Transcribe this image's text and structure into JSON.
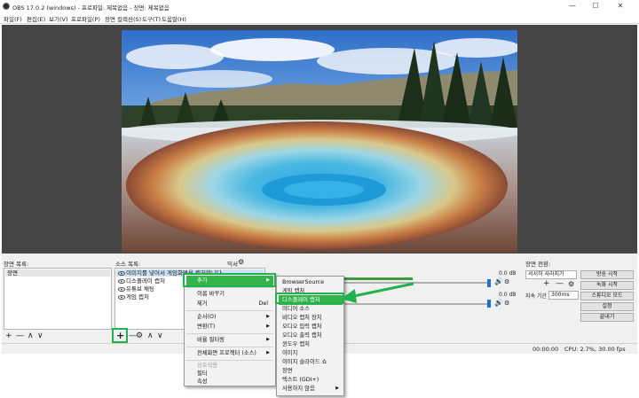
{
  "window": {
    "title": "OBS 17.0.2 (windows) - 프로파일: 제목없음 - 장면: 제목없음",
    "minimize": "—",
    "maximize": "☐",
    "close": "✕"
  },
  "menubar": [
    "파일(F)",
    "편집(E)",
    "보기(V)",
    "프로파일(P)",
    "장면 컬렉션(S)",
    "도구(T)",
    "도움말(H)"
  ],
  "panels": {
    "scenes_label": "장면 목록:",
    "scenes": [
      "장면"
    ],
    "sources_label": "소스 목록:",
    "sources": [
      "이미지를 넣어서 게임화면을 캡처합니다",
      "디스플레이 캡처",
      "유튜브 채팅",
      "게임 캡처"
    ],
    "mixer_label": "믹서",
    "transition_label": "장면 전환:",
    "transition_value": "서서히 사라지기",
    "duration_label": "지속 기간",
    "duration_value": "300ms"
  },
  "toolbar_glyphs": {
    "plus": "+",
    "minus": "—",
    "up": "∧",
    "down": "∨",
    "gear": "⚙"
  },
  "mixer": [
    {
      "level": "0.0 dB",
      "fill": 0.68
    },
    {
      "level": "0.0 dB",
      "fill": 0.08
    }
  ],
  "buttons": [
    "방송 시작",
    "녹화 시작",
    "스튜디오 모드",
    "설정",
    "끝내기"
  ],
  "status": {
    "time": "00:00:00",
    "cpu": "CPU: 2.7%, 30.00 fps"
  },
  "context_menu": {
    "items": [
      {
        "label": "추가",
        "arrow": "▶",
        "highlight": true
      },
      {
        "label": "이름 바꾸기",
        "shortcut": ""
      },
      {
        "label": "제거",
        "shortcut": "Del"
      },
      {
        "label": "순서(O)",
        "arrow": "▶"
      },
      {
        "label": "변환(T)",
        "arrow": "▶"
      },
      {
        "label": "비율 필터링",
        "arrow": "▶"
      },
      {
        "label": "전체화면 프로젝터 (소스)",
        "arrow": "▶"
      },
      {
        "label": "상호작용",
        "disabled": true
      },
      {
        "label": "필터"
      },
      {
        "label": "속성"
      }
    ]
  },
  "submenu": {
    "items": [
      {
        "label": "BrowserSource"
      },
      {
        "label": "게임 캡처"
      },
      {
        "label": "디스플레이 캡처",
        "highlight": true
      },
      {
        "label": "미디어 소스"
      },
      {
        "label": "비디오 캡처 장치"
      },
      {
        "label": "오디오 입력 캡처"
      },
      {
        "label": "오디오 출력 캡처"
      },
      {
        "label": "윈도우 캡처"
      },
      {
        "label": "이미지"
      },
      {
        "label": "이미지 슬라이드 쇼"
      },
      {
        "label": "장면"
      },
      {
        "label": "텍스트 (GDI+)"
      },
      {
        "label": "사용하지 않음",
        "arrow": "▶"
      }
    ]
  },
  "colors": {
    "accent_green": "#22b14c",
    "workspace_bg": "#454545",
    "meter_green": "#3e9a3e",
    "volume_handle": "#1d6fd1"
  },
  "icons": {
    "visibility": "eye-icon",
    "settings": "gear-icon",
    "speaker": "speaker-icon",
    "callout": "green-arrow-icon"
  }
}
